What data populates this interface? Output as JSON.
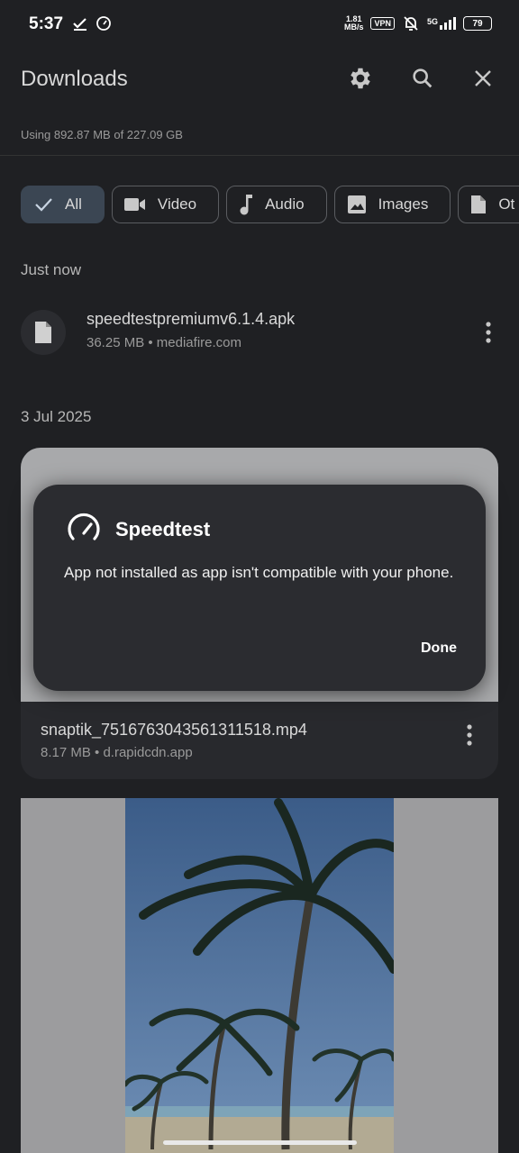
{
  "status_bar": {
    "time": "5:37",
    "net_speed_value": "1.81",
    "net_speed_unit": "MB/s",
    "vpn": "VPN",
    "network": "5G",
    "battery": "79"
  },
  "app_bar": {
    "title": "Downloads"
  },
  "storage": {
    "text": "Using 892.87 MB of 227.09 GB"
  },
  "filters": [
    {
      "label": "All",
      "icon": "check-icon",
      "selected": true
    },
    {
      "label": "Video",
      "icon": "video-icon"
    },
    {
      "label": "Audio",
      "icon": "music-note-icon"
    },
    {
      "label": "Images",
      "icon": "image-icon"
    },
    {
      "label": "Ot",
      "icon": "document-icon"
    }
  ],
  "sections": [
    {
      "title": "Just now",
      "items": [
        {
          "name": "speedtestpremiumv6.1.4.apk",
          "meta": "36.25 MB • mediafire.com",
          "icon": "file-icon"
        }
      ]
    },
    {
      "title": "3 Jul 2025",
      "items": [
        {
          "name": "snaptik_7516763043561311518.mp4",
          "meta": "8.17 MB • d.rapidcdn.app",
          "icon": "video-thumbnail"
        },
        {
          "name": "",
          "meta": "",
          "icon": "palm-tree-image"
        }
      ]
    }
  ],
  "dialog": {
    "title": "Speedtest",
    "icon": "speedometer-icon",
    "message": "App not installed as app isn't compatible with your phone.",
    "button": "Done"
  },
  "colors": {
    "background": "#1f2023",
    "dialog": "#2b2c30",
    "chip_selected": "#3b4653",
    "sky": "#4a6b95"
  }
}
